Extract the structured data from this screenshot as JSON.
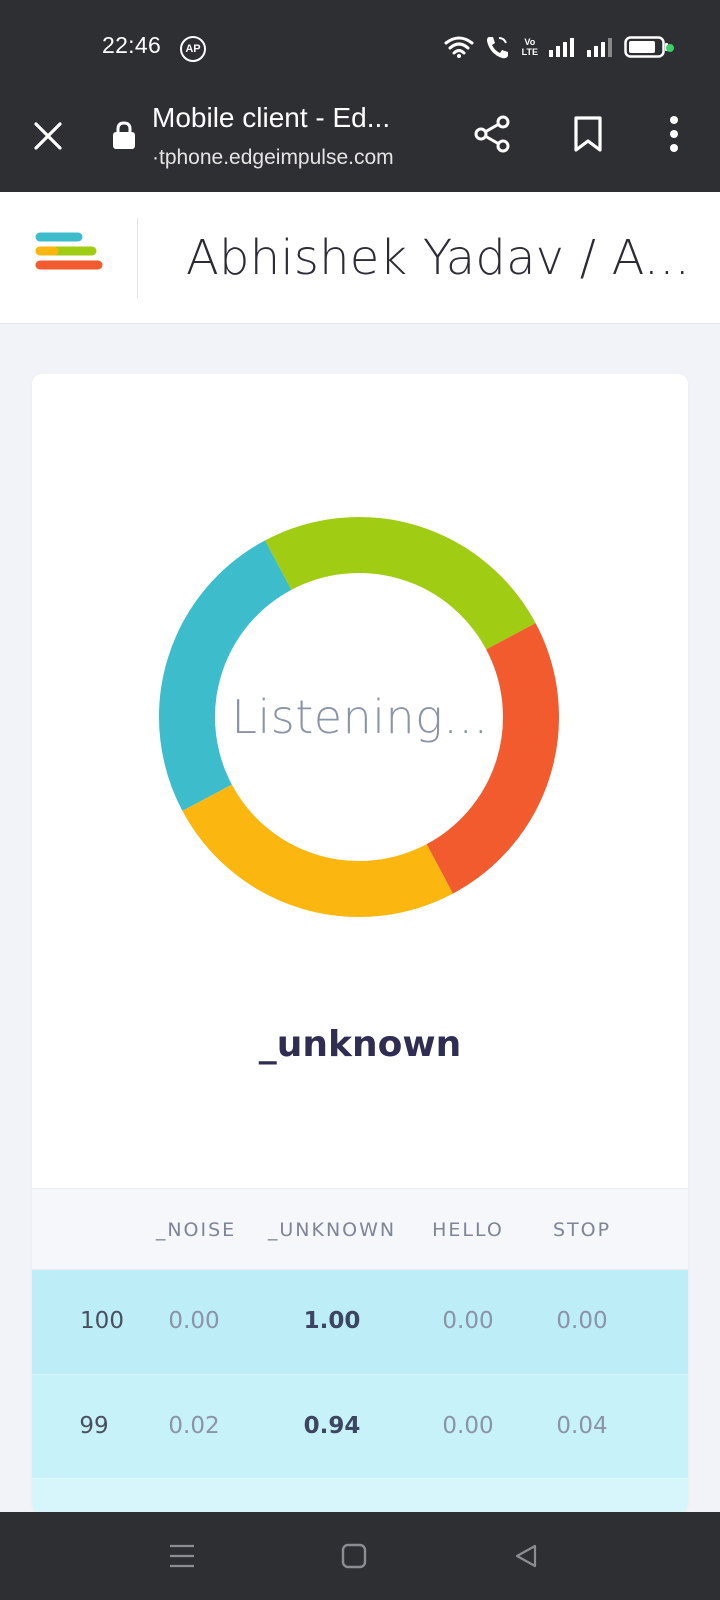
{
  "status_bar": {
    "time": "22:46",
    "ap_badge": "AP",
    "volte_top": "Vo",
    "volte_bottom": "LTE"
  },
  "browser": {
    "page_title": "Mobile client - Ed...",
    "url": "·tphone.edgeimpulse.com",
    "icons": [
      "close-icon",
      "lock-icon",
      "share-icon",
      "bookmark-icon",
      "more-vert-icon"
    ]
  },
  "header": {
    "project_title": "Abhishek Yadav / A..."
  },
  "donut": {
    "label": "Listening...",
    "colors": [
      "#3dbccc",
      "#a0cc14",
      "#f25b2e",
      "#fbb710"
    ]
  },
  "classification": "_unknown",
  "table": {
    "columns": [
      "_NOISE",
      "_UNKNOWN",
      "HELLO",
      "STOP"
    ],
    "rows": [
      {
        "index": "100",
        "values": [
          "0.00",
          "1.00",
          "0.00",
          "0.00"
        ]
      },
      {
        "index": "99",
        "values": [
          "0.02",
          "0.94",
          "0.00",
          "0.04"
        ]
      }
    ],
    "highlight_column": 1
  },
  "nav": {
    "icons": [
      "recent-apps-icon",
      "home-icon",
      "back-icon"
    ]
  },
  "colors": {
    "dark_bar": "#2e2f33",
    "row_highlight": "#bdeef8",
    "title_text": "#2f2d52"
  }
}
